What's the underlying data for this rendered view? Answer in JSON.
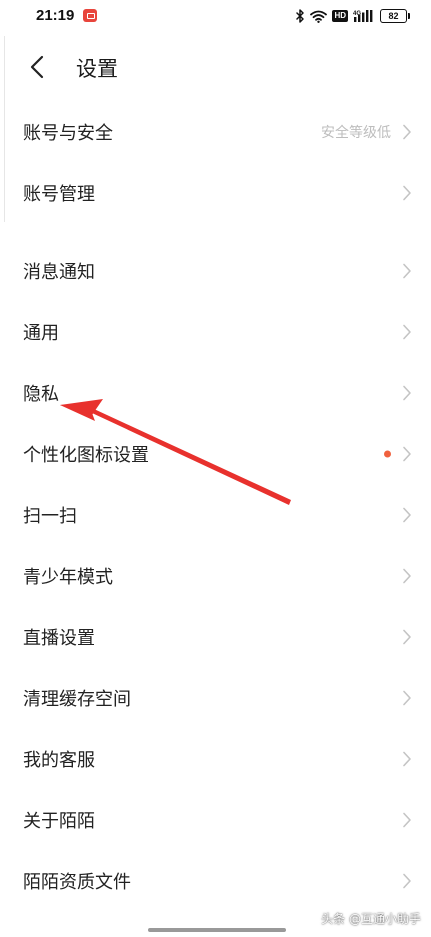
{
  "status_bar": {
    "time": "21:19",
    "network_label": "4G",
    "hd_label": "HD",
    "battery_level": "82",
    "icons": [
      "app-notification-icon",
      "bluetooth-icon",
      "wifi-icon",
      "cellular-signal-icon",
      "battery-icon"
    ]
  },
  "header": {
    "back_icon": "chevron-left-icon",
    "title": "设置"
  },
  "menu": {
    "items": [
      {
        "label": "账号与安全",
        "value": "安全等级低"
      },
      {
        "label": "账号管理"
      },
      {
        "label": "消息通知"
      },
      {
        "label": "通用"
      },
      {
        "label": "隐私"
      },
      {
        "label": "个性化图标设置",
        "badge": "red-dot"
      },
      {
        "label": "扫一扫"
      },
      {
        "label": "青少年模式"
      },
      {
        "label": "直播设置"
      },
      {
        "label": "清理缓存空间"
      },
      {
        "label": "我的客服"
      },
      {
        "label": "关于陌陌"
      },
      {
        "label": "陌陌资质文件"
      }
    ]
  },
  "annotation": {
    "type": "arrow",
    "color": "#e8312d",
    "points_to": "隐私"
  },
  "colors": {
    "badge_dot": "#f0613e",
    "secondary_text": "#bdbdbd",
    "chevron": "#c4c4c4"
  },
  "watermark": "头条 @互通小助手"
}
